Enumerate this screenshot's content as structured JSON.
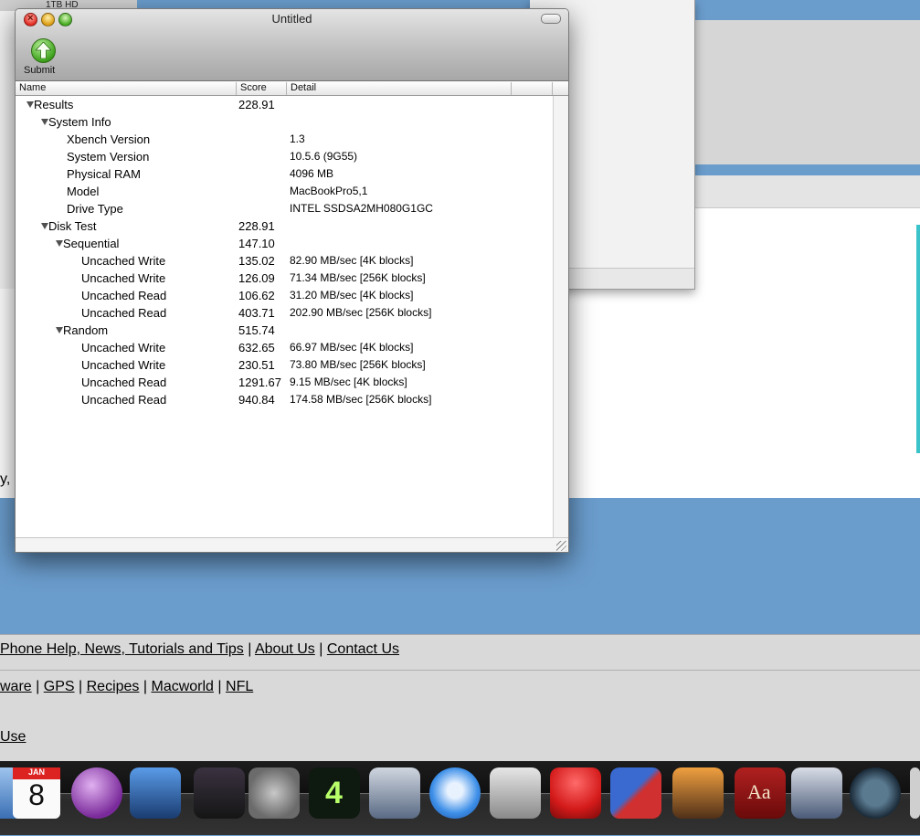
{
  "background_page": {
    "top_fragment": "1TB HD",
    "side_fragment": "y,",
    "footer_line1": [
      "Phone Help, News, Tutorials and Tips",
      "About Us",
      "Contact Us"
    ],
    "footer_line2": [
      "ware",
      "GPS",
      "Recipes",
      "Macworld",
      "NFL"
    ],
    "footer_line3": "Use",
    "separator": "|"
  },
  "window": {
    "title": "Untitled",
    "toolbar": {
      "submit_label": "Submit"
    },
    "columns": [
      "Name",
      "Score",
      "Detail"
    ],
    "rows": [
      {
        "name": "Results",
        "score": "228.91",
        "detail": "",
        "level": 0,
        "expanded": true
      },
      {
        "name": "System Info",
        "score": "",
        "detail": "",
        "level": 1,
        "expanded": true
      },
      {
        "name": "Xbench Version",
        "score": "",
        "detail": "1.3",
        "level": 2
      },
      {
        "name": "System Version",
        "score": "",
        "detail": "10.5.6 (9G55)",
        "level": 2
      },
      {
        "name": "Physical RAM",
        "score": "",
        "detail": "4096 MB",
        "level": 2
      },
      {
        "name": "Model",
        "score": "",
        "detail": "MacBookPro5,1",
        "level": 2
      },
      {
        "name": "Drive Type",
        "score": "",
        "detail": "INTEL SSDSA2MH080G1GC",
        "level": 2
      },
      {
        "name": "Disk Test",
        "score": "228.91",
        "detail": "",
        "level": 1,
        "expanded": true
      },
      {
        "name": "Sequential",
        "score": "147.10",
        "detail": "",
        "level": 2,
        "expanded": true
      },
      {
        "name": "Uncached Write",
        "score": "135.02",
        "detail": "82.90 MB/sec [4K blocks]",
        "level": 3
      },
      {
        "name": "Uncached Write",
        "score": "126.09",
        "detail": "71.34 MB/sec [256K blocks]",
        "level": 3
      },
      {
        "name": "Uncached Read",
        "score": "106.62",
        "detail": "31.20 MB/sec [4K blocks]",
        "level": 3
      },
      {
        "name": "Uncached Read",
        "score": "403.71",
        "detail": "202.90 MB/sec [256K blocks]",
        "level": 3
      },
      {
        "name": "Random",
        "score": "515.74",
        "detail": "",
        "level": 2,
        "expanded": true
      },
      {
        "name": "Uncached Write",
        "score": "632.65",
        "detail": "66.97 MB/sec [4K blocks]",
        "level": 3
      },
      {
        "name": "Uncached Write",
        "score": "230.51",
        "detail": "73.80 MB/sec [256K blocks]",
        "level": 3
      },
      {
        "name": "Uncached Read",
        "score": "1291.67",
        "detail": "9.15 MB/sec [4K blocks]",
        "level": 3
      },
      {
        "name": "Uncached Read",
        "score": "940.84",
        "detail": "174.58 MB/sec [256K blocks]",
        "level": 3
      }
    ]
  },
  "dock": {
    "calendar_month": "JAN",
    "calendar_day": "8",
    "dictionary_glyph": "Aa",
    "app4_glyph": "4",
    "icons": [
      "finder-icon",
      "ical-icon",
      "adium-icon",
      "preview-icon",
      "photo-booth-icon",
      "system-preferences-icon",
      "app-4-icon",
      "iphoto-icon",
      "itunes-icon",
      "script-editor-icon",
      "magnet-icon",
      "vmware-icon",
      "image-capture-icon",
      "dictionary-icon",
      "spaces-icon",
      "time-machine-icon"
    ],
    "colors": {
      "itunes": "#3d8fe8",
      "magnet": "#d41a1a"
    }
  }
}
